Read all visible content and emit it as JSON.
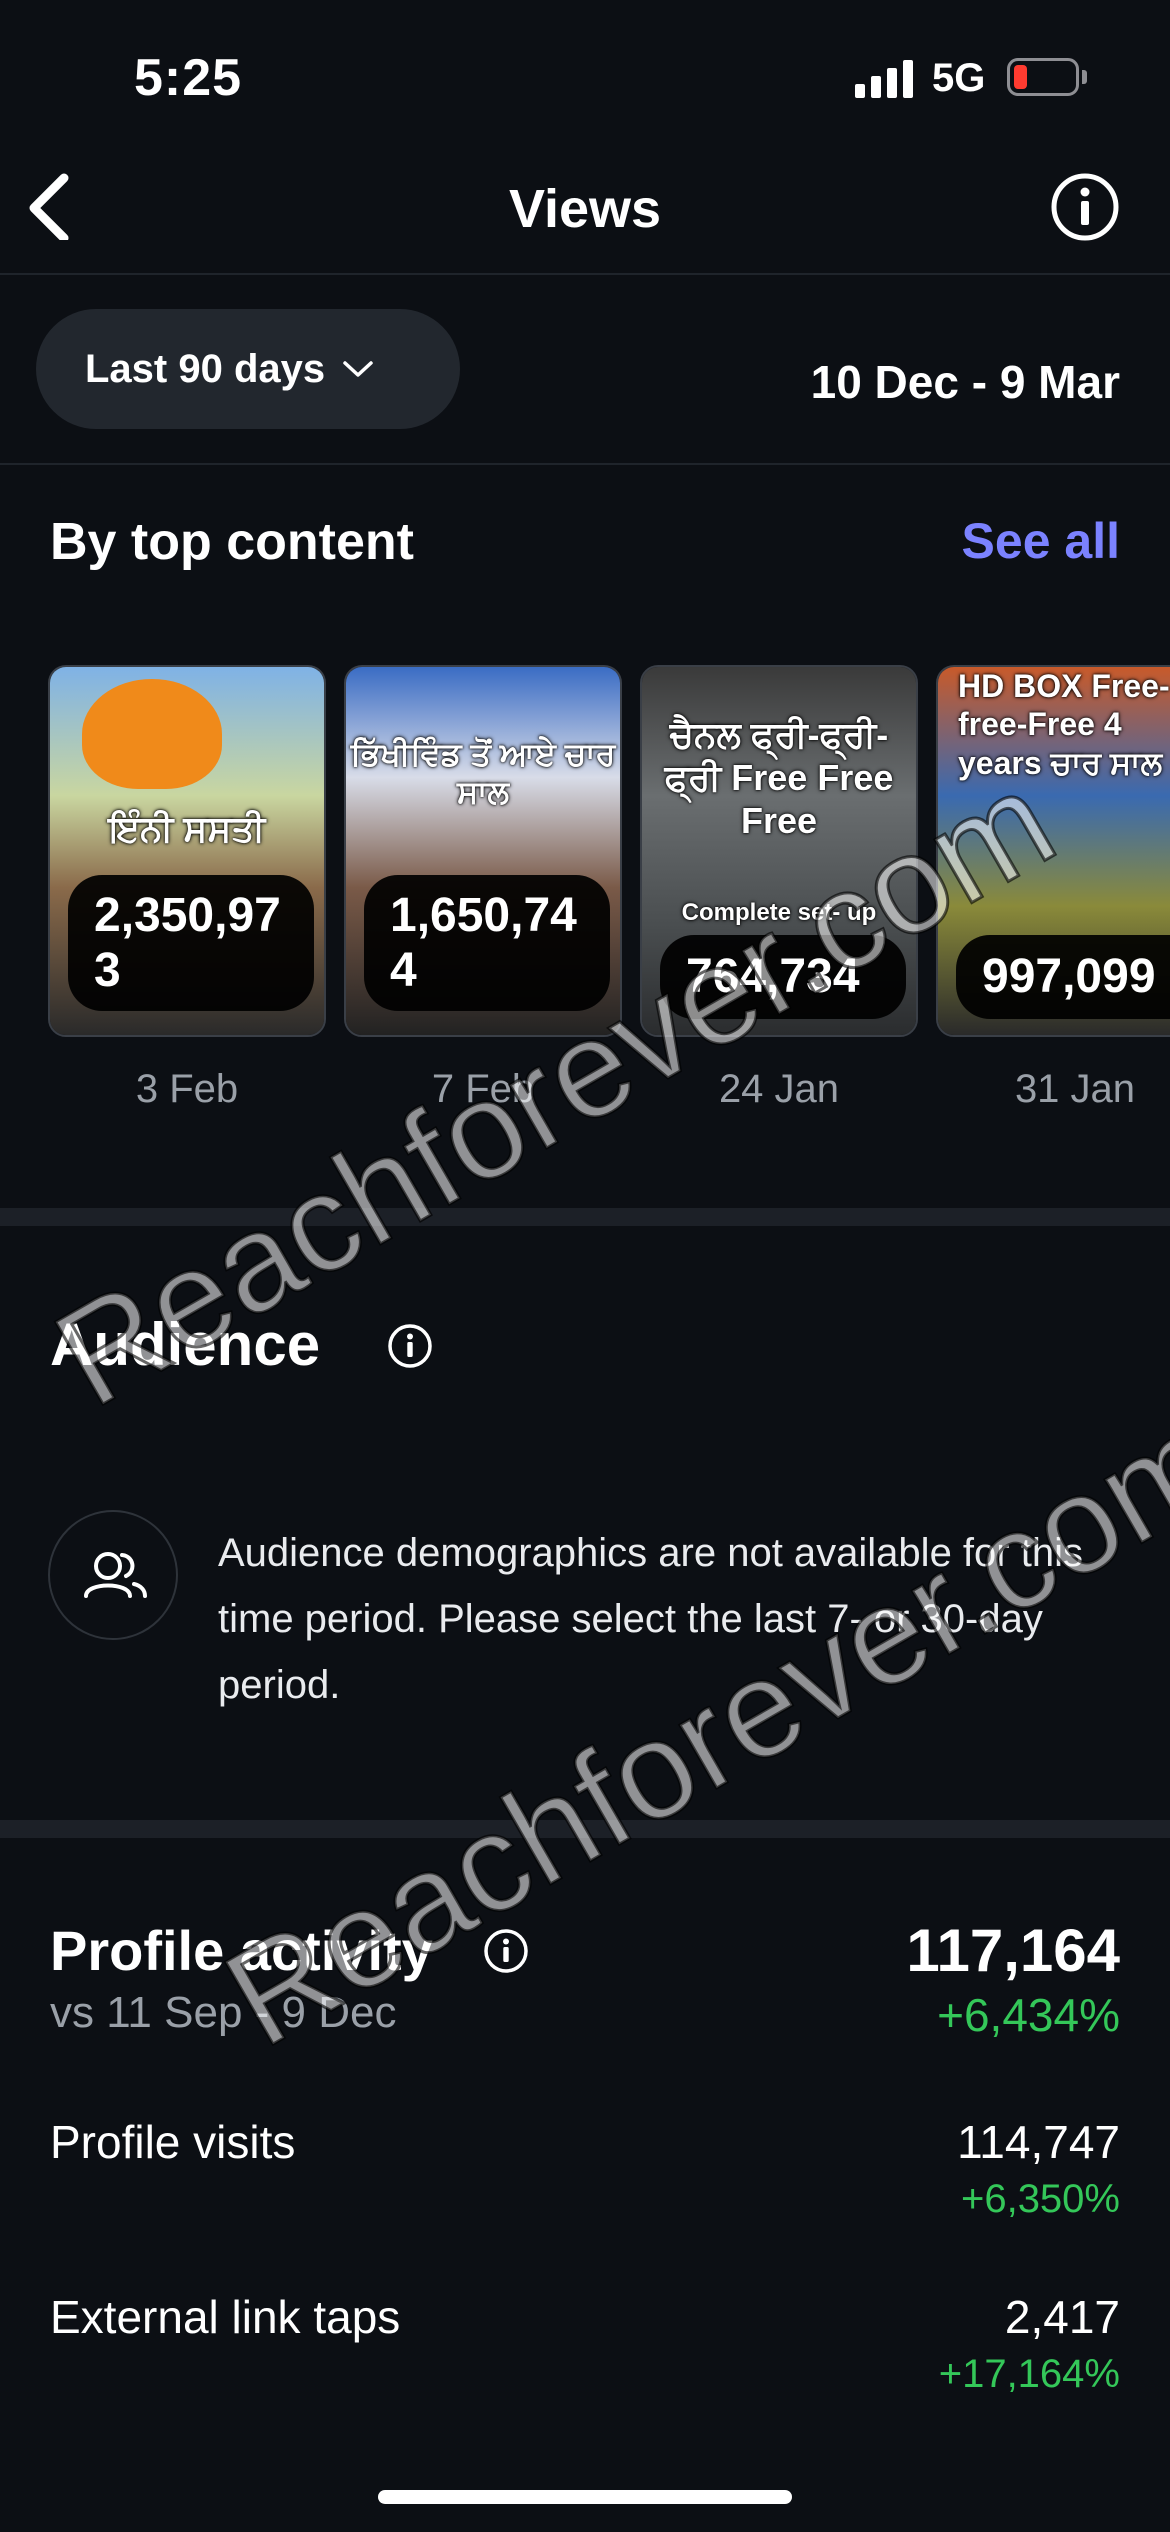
{
  "status_bar": {
    "time": "5:25",
    "network": "5G"
  },
  "nav": {
    "title": "Views"
  },
  "filter": {
    "range_label": "Last 90 days",
    "date_range": "10 Dec - 9 Mar"
  },
  "top_content": {
    "title": "By top content",
    "see_all": "See all",
    "cards": [
      {
        "thumb_text": "ਇੰਨੀ ਸਸਤੀ",
        "views_line1": "2,350,97",
        "views_line2": "3",
        "date": "3 Feb"
      },
      {
        "thumb_text": "ਭਿੱਖੀਵਿੰਡ ਤੋਂ ਆਏ ਚਾਰ ਸਾਲ",
        "views_line1": "1,650,74",
        "views_line2": "4",
        "date": "7 Feb"
      },
      {
        "thumb_text": "ਚੈਨਲ ਫ੍ਰੀ-ਫ੍ਰੀ-ਫ੍ਰੀ Free Free Free",
        "thumb_sub": "Complete set- up",
        "views_line1": "764,734",
        "views_line2": "",
        "date": "24 Jan"
      },
      {
        "thumb_text": "HD BOX Free-free-Free 4 years ਚਾਰ ਸਾਲ",
        "views_line1": "997,099",
        "views_line2": "",
        "date": "31 Jan"
      }
    ]
  },
  "audience": {
    "title": "Audience",
    "message": "Audience demographics are not available for this time period. Please select the last 7- or 30-day period."
  },
  "profile_activity": {
    "title": "Profile activity",
    "comparison": "vs 11 Sep - 9 Dec",
    "total": "117,164",
    "total_delta": "+6,434%",
    "rows": [
      {
        "label": "Profile visits",
        "value": "114,747",
        "delta": "+6,350%"
      },
      {
        "label": "External link taps",
        "value": "2,417",
        "delta": "+17,164%"
      }
    ]
  },
  "watermark": {
    "text": "Reachforever.com"
  },
  "colors": {
    "background": "#0c0f14",
    "accent": "#7b82ff",
    "positive": "#34c759"
  }
}
